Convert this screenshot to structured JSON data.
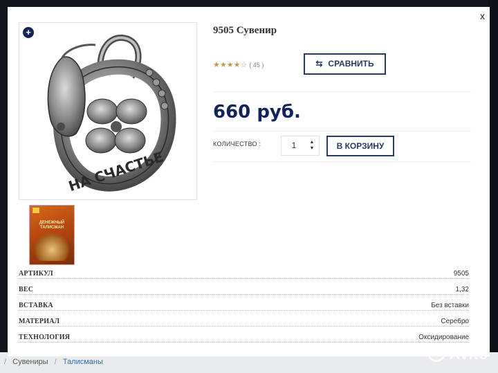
{
  "modal": {
    "close_label": "x",
    "product_title": "9505 Сувенир",
    "zoom_label": "+",
    "rating": {
      "stars": "★★★★☆",
      "value": 4,
      "count_text": "( 45 )"
    },
    "compare_button": {
      "icon": "compare-arrows-icon",
      "icon_glyph": "⇆",
      "label": "СРАВНИТЬ"
    },
    "price": "660 руб.",
    "quantity": {
      "label": "КОЛИЧЕСТВО :",
      "value": "1"
    },
    "cart_button": "В КОРЗИНУ",
    "thumbnail": {
      "title_text": "ДЕНЕЖНЫЙ ТАЛИСМАН"
    },
    "specs": [
      {
        "key": "АРТИКУЛ",
        "value": "9505"
      },
      {
        "key": "ВЕС",
        "value": "1,32"
      },
      {
        "key": "ВСТАВКА",
        "value": "Без вставки"
      },
      {
        "key": "МАТЕРИАЛ",
        "value": "Серебро"
      },
      {
        "key": "ТЕХНОЛОГИЯ",
        "value": "Оксидирование"
      }
    ]
  },
  "breadcrumb": {
    "items": [
      "Сувениры",
      "Талисманы"
    ],
    "separator": "/"
  },
  "watermark": "Avito",
  "colors": {
    "brand_navy": "#14235a",
    "button_border": "#2a3a5e",
    "star": "#c19a4a"
  }
}
